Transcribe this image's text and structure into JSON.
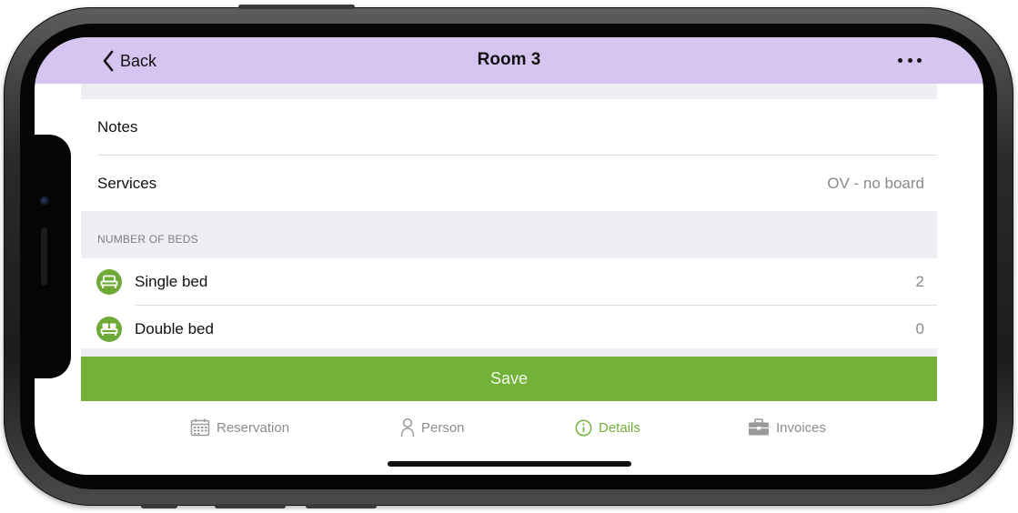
{
  "navbar": {
    "back_label": "Back",
    "title": "Room 3",
    "more_icon": "ellipsis-icon"
  },
  "details": {
    "notes_label": "Notes",
    "services_label": "Services",
    "services_value": "OV - no board"
  },
  "beds": {
    "section_header": "NUMBER OF BEDS",
    "items": [
      {
        "label": "Single bed",
        "value": "2",
        "icon": "single-bed-icon"
      },
      {
        "label": "Double bed",
        "value": "0",
        "icon": "double-bed-icon"
      }
    ]
  },
  "actions": {
    "save_label": "Save"
  },
  "tabs": [
    {
      "label": "Reservation",
      "icon": "calendar-icon",
      "active": false
    },
    {
      "label": "Person",
      "icon": "person-icon",
      "active": false
    },
    {
      "label": "Details",
      "icon": "info-icon",
      "active": true
    },
    {
      "label": "Invoices",
      "icon": "briefcase-icon",
      "active": false
    }
  ],
  "colors": {
    "navbar_bg": "#d7c5f1",
    "accent_green": "#73b239",
    "icon_green": "#6faa38",
    "group_bg": "#efeef4"
  }
}
